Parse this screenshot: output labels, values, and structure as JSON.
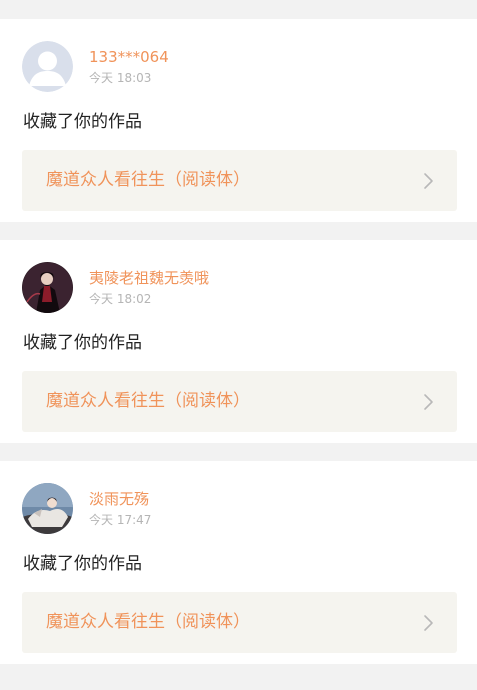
{
  "notifications": [
    {
      "user": "133***064",
      "time": "今天 18:03",
      "action": "收藏了你的作品",
      "work_title": "魔道众人看往生（阅读体）",
      "avatar": "default-user-icon"
    },
    {
      "user": "夷陵老祖魏无羡哦",
      "time": "今天 18:02",
      "action": "收藏了你的作品",
      "work_title": "魔道众人看往生（阅读体）",
      "avatar": "anime-character-dark-avatar"
    },
    {
      "user": "淡雨无殇",
      "time": "今天 17:47",
      "action": "收藏了你的作品",
      "work_title": "魔道众人看往生（阅读体）",
      "avatar": "anime-character-light-avatar"
    }
  ],
  "colors": {
    "accent": "#f0935a",
    "timestamp": "#b5b5b5",
    "background": "#f2f2f2",
    "work_card": "#f5f4ef"
  },
  "icons": {
    "chevron": "chevron-right-icon"
  }
}
